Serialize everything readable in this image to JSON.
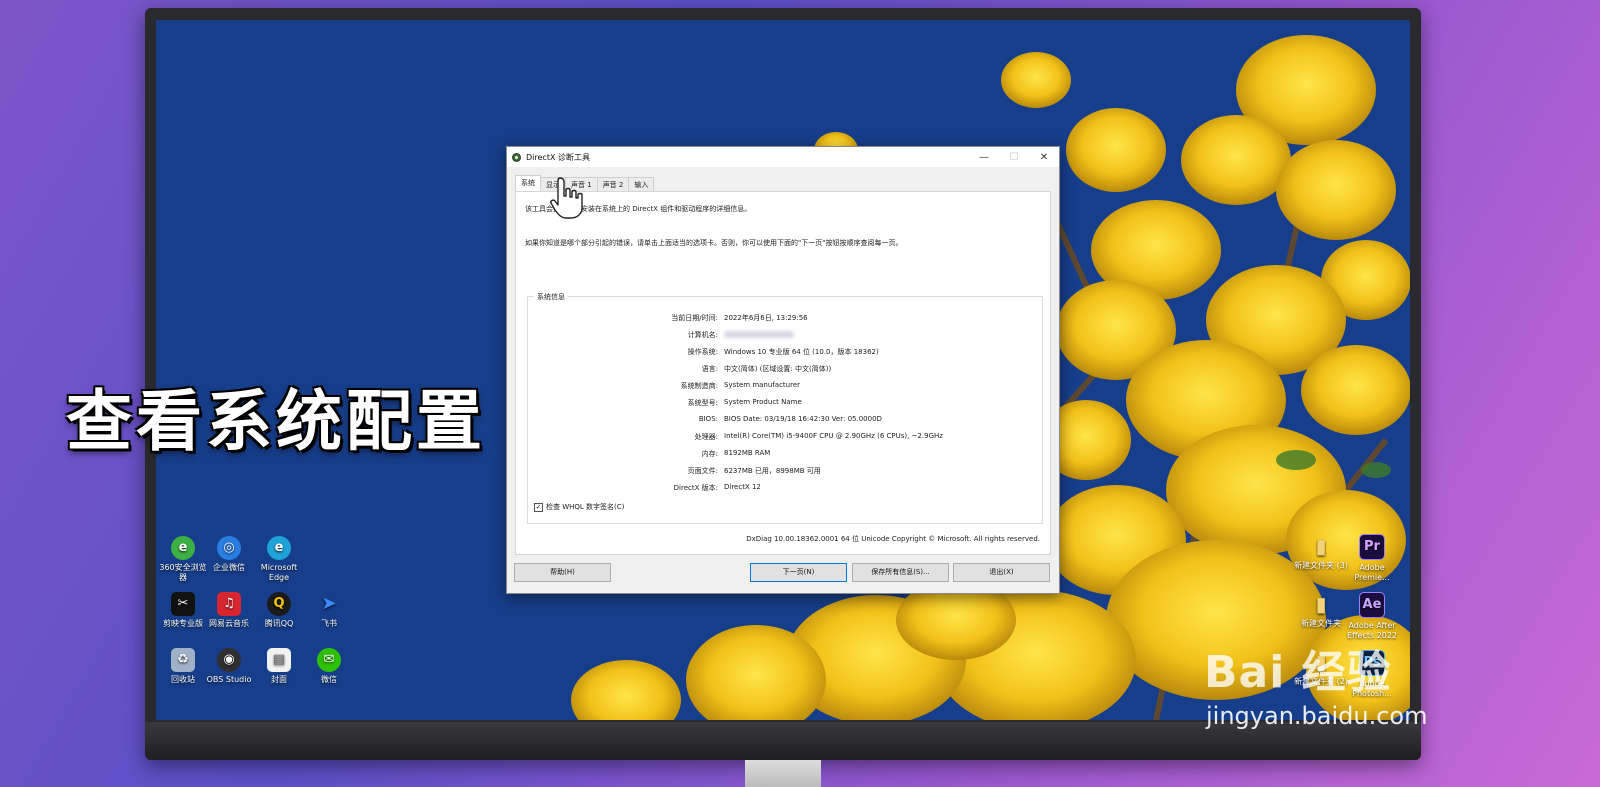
{
  "caption": "查看系统配置",
  "desktop": {
    "left_icons": [
      {
        "label": "360安全浏览器",
        "glyph": "e",
        "color": "#3cb043"
      },
      {
        "label": "企业微信",
        "glyph": "◎",
        "color": "#2a7de1"
      },
      {
        "label": "Microsoft Edge",
        "glyph": "e",
        "color": "#1fa2d6"
      },
      {
        "label": "剪映专业版",
        "glyph": "✂",
        "color": "#111111"
      },
      {
        "label": "网易云音乐",
        "glyph": "♫",
        "color": "#d7262f"
      },
      {
        "label": "腾讯QQ",
        "glyph": "Q",
        "color": "#1b1b1b"
      },
      {
        "label": "飞书",
        "glyph": "➤",
        "color": "#2f7cf6"
      },
      {
        "label": "回收站",
        "glyph": "♻",
        "color": "#9fb2c8"
      },
      {
        "label": "OBS Studio",
        "glyph": "◉",
        "color": "#302e31"
      },
      {
        "label": "封面",
        "glyph": "▤",
        "color": "#f2f2f2"
      },
      {
        "label": "微信",
        "glyph": "✉",
        "color": "#2dc100"
      }
    ],
    "right_icons": [
      {
        "label": "新建文件夹 (3)",
        "glyph": "▮",
        "color": "#f3d27a"
      },
      {
        "label": "Adobe Premie...",
        "glyph": "Pr",
        "color": "#1a0d3d"
      },
      {
        "label": "新建文件夹",
        "glyph": "▮",
        "color": "#f3d27a"
      },
      {
        "label": "Adobe After Effects 2022",
        "glyph": "Ae",
        "color": "#1a0d3d"
      },
      {
        "label": "新建文件夹 (2)",
        "glyph": "▮",
        "color": "#f3d27a"
      },
      {
        "label": "Adobe Photosh...",
        "glyph": "Ps",
        "color": "#0d1d3d"
      }
    ]
  },
  "window": {
    "title": "DirectX 诊断工具",
    "minimize": "—",
    "maximize": "☐",
    "close": "✕",
    "tabs": [
      "系统",
      "显示",
      "声音 1",
      "声音 2",
      "输入"
    ],
    "intro1": "该工具会报告有关安装在系统上的 DirectX 组件和驱动程序的详细信息。",
    "intro2": "如果你知道是哪个部分引起的错误，请单击上面适当的选项卡。否则，你可以使用下面的\"下一页\"按钮按顺序查阅每一页。",
    "group_title": "系统信息",
    "rows": [
      {
        "label": "当前日期/时间:",
        "value": "2022年6月6日, 13:29:56"
      },
      {
        "label": "计算机名:",
        "value": ""
      },
      {
        "label": "操作系统:",
        "value": "Windows 10 专业版 64 位 (10.0，版本 18362)"
      },
      {
        "label": "语言:",
        "value": "中文(简体) (区域设置: 中文(简体))"
      },
      {
        "label": "系统制造商:",
        "value": "System manufacturer"
      },
      {
        "label": "系统型号:",
        "value": "System Product Name"
      },
      {
        "label": "BIOS:",
        "value": "BIOS Date: 03/19/18 16:42:30 Ver: 05.0000D"
      },
      {
        "label": "处理器:",
        "value": "Intel(R) Core(TM) i5-9400F CPU @ 2.90GHz (6 CPUs), ~2.9GHz"
      },
      {
        "label": "内存:",
        "value": "8192MB RAM"
      },
      {
        "label": "页面文件:",
        "value": "6237MB 已用，8998MB 可用"
      },
      {
        "label": "DirectX 版本:",
        "value": "DirectX 12"
      }
    ],
    "whql_label": "检查 WHQL 数字签名(C)",
    "whql_checked": true,
    "footer": "DxDiag 10.00.18362.0001 64 位 Unicode  Copyright © Microsoft. All rights reserved.",
    "buttons": {
      "help": "帮助(H)",
      "next": "下一页(N)",
      "save": "保存所有信息(S)...",
      "exit": "退出(X)"
    }
  },
  "watermark": {
    "logo": "Bai 经验",
    "url": "jingyan.baidu.com"
  }
}
